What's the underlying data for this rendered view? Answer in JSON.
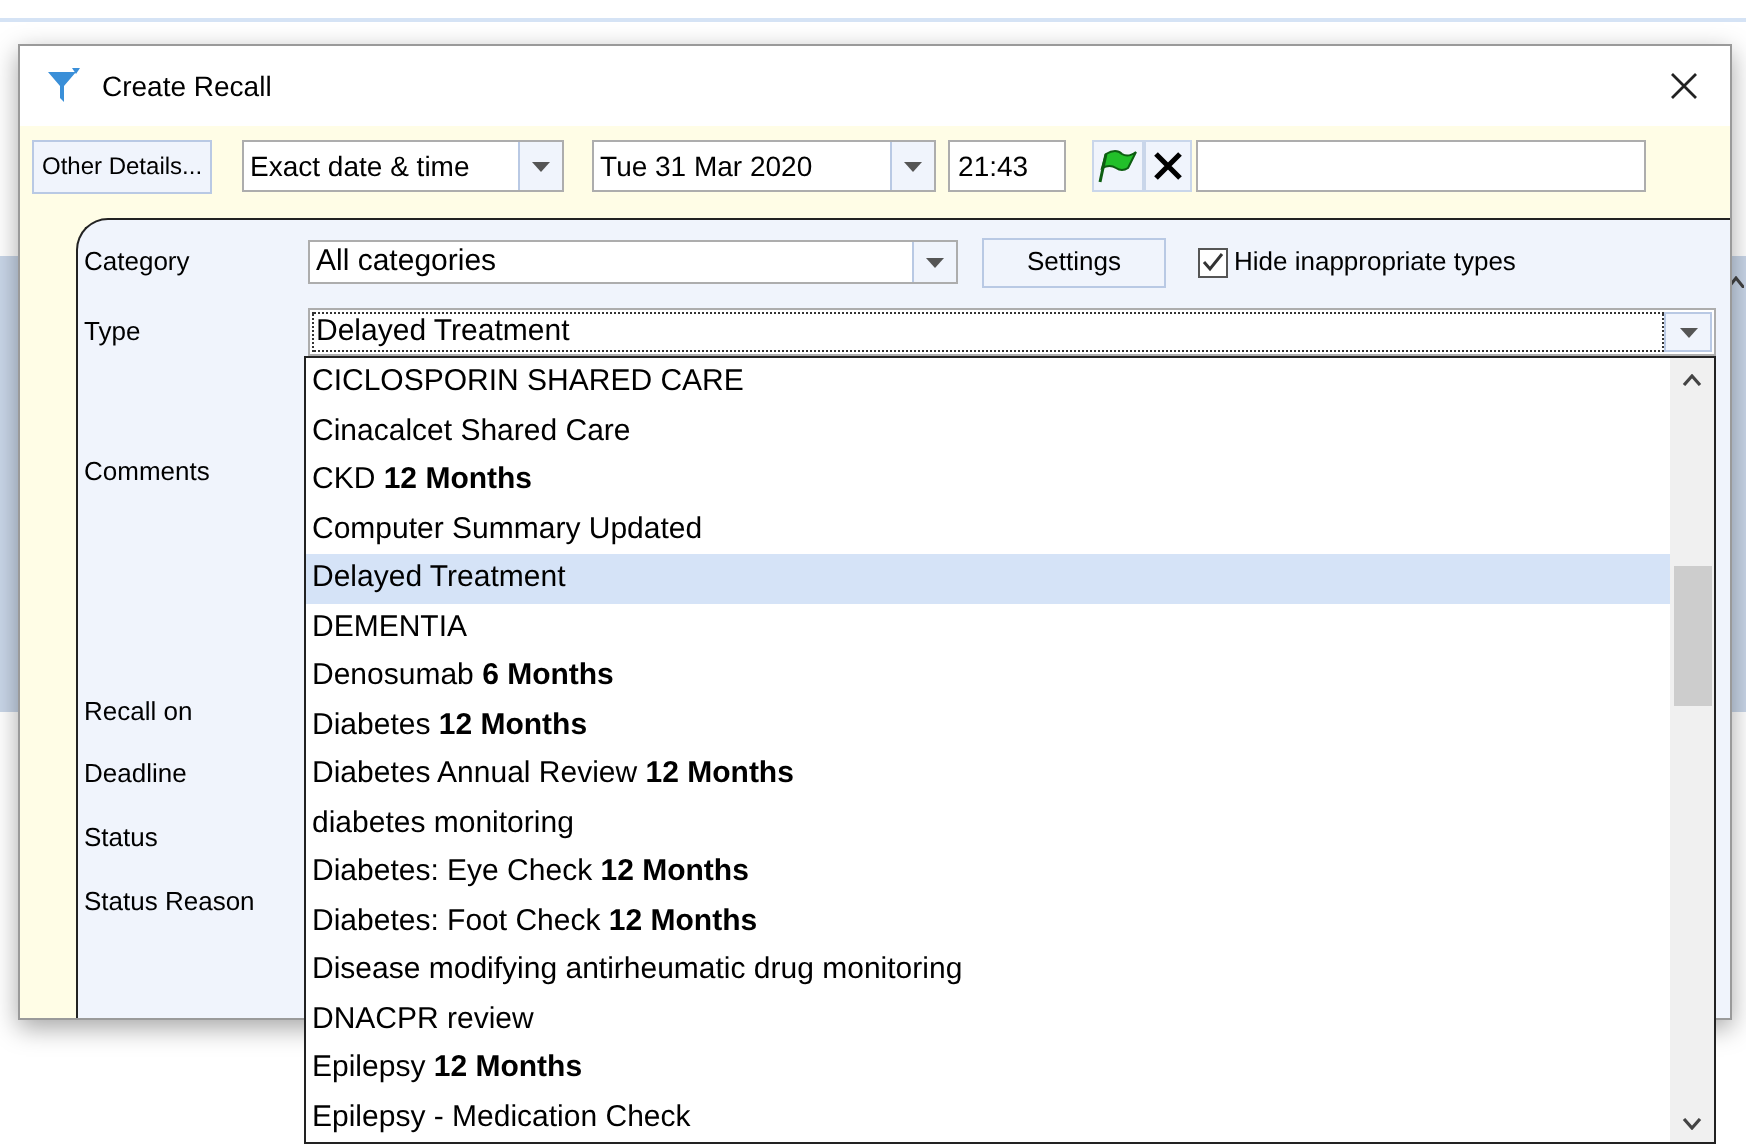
{
  "window": {
    "title": "Create Recall"
  },
  "toolbar": {
    "other_details": "Other Details...",
    "date_mode": "Exact date & time",
    "date": "Tue 31 Mar 2020",
    "time": "21:43"
  },
  "form": {
    "category_label": "Category",
    "category_value": "All categories",
    "settings": "Settings",
    "hide_inappropriate": {
      "label": "Hide inappropriate types",
      "checked": true
    },
    "type_label": "Type",
    "type_value": "Delayed Treatment",
    "labels": [
      "Comments",
      "Recall on",
      "Deadline",
      "Status",
      "Status Reason"
    ]
  },
  "type_dropdown": {
    "items": [
      {
        "text": "CICLOSPORIN SHARED CARE",
        "selected": false
      },
      {
        "text": "Cinacalcet Shared Care",
        "selected": false
      },
      {
        "text": "CKD **12 Months**",
        "selected": false
      },
      {
        "text": "Computer Summary Updated",
        "selected": false
      },
      {
        "text": "Delayed Treatment",
        "selected": true
      },
      {
        "text": "DEMENTIA",
        "selected": false
      },
      {
        "text": "Denosumab **6 Months**",
        "selected": false
      },
      {
        "text": "Diabetes **12 Months**",
        "selected": false
      },
      {
        "text": "Diabetes Annual Review **12 Months**",
        "selected": false
      },
      {
        "text": "diabetes monitoring",
        "selected": false
      },
      {
        "text": "Diabetes: Eye Check **12 Months**",
        "selected": false
      },
      {
        "text": "Diabetes: Foot Check **12 Months**",
        "selected": false
      },
      {
        "text": "Disease modifying antirheumatic drug monitoring",
        "selected": false
      },
      {
        "text": "DNACPR review",
        "selected": false
      },
      {
        "text": "Epilepsy **12 Months**",
        "selected": false
      },
      {
        "text": "Epilepsy - Medication Check",
        "selected": false
      }
    ]
  }
}
